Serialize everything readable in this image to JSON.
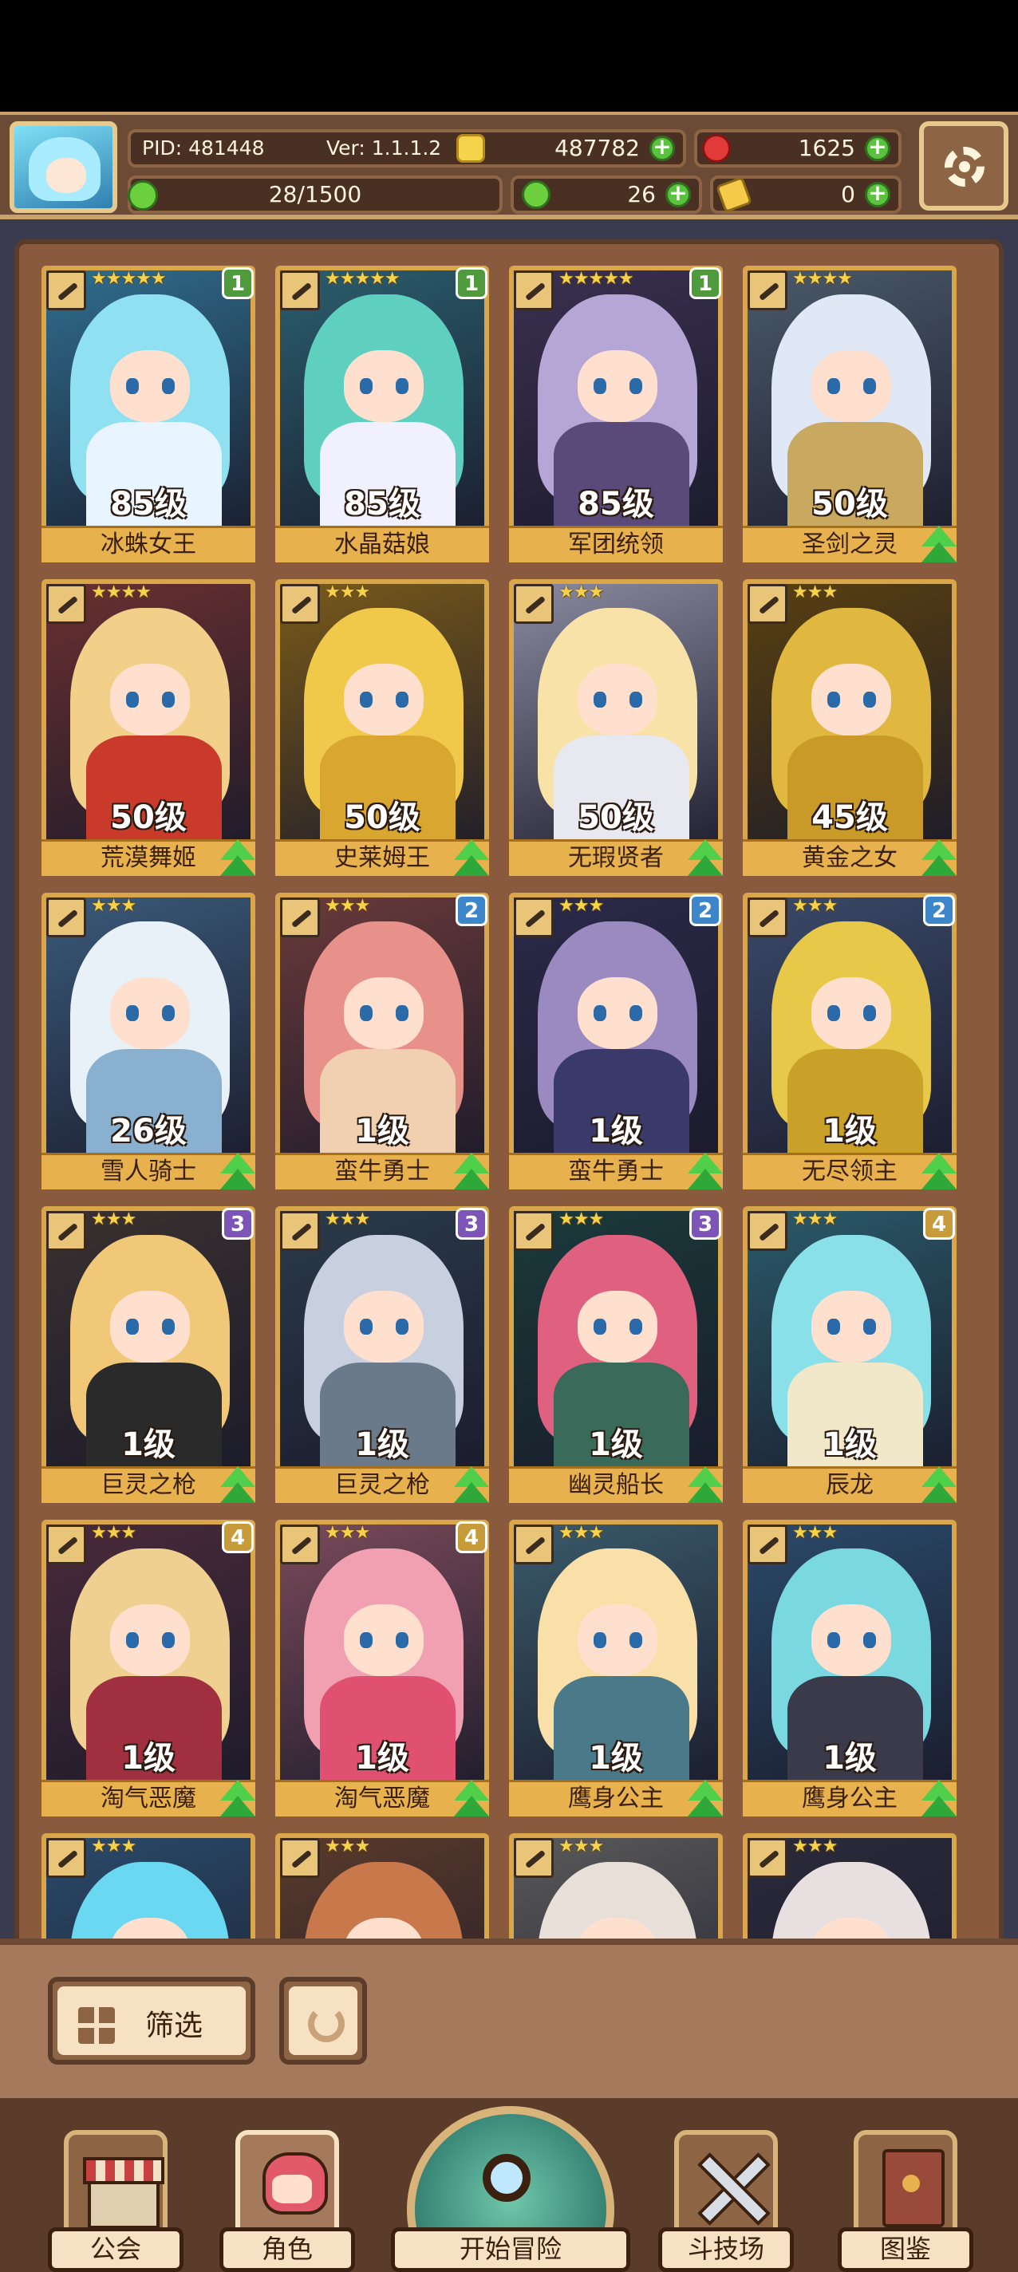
{
  "header": {
    "pid": "PID: 481448",
    "version": "Ver: 1.1.1.2",
    "gold": "487782",
    "gems": "1625",
    "energy": "28/1500",
    "clover": "26",
    "tokens": "0"
  },
  "cards": [
    {
      "name": "冰蛛女王",
      "level": "85级",
      "stars": "★★★★★",
      "rank": "1",
      "rank_color": "green",
      "upgrade": false,
      "palette": [
        "#2f6e8e",
        "#8fe0f0",
        "#e8f4ff"
      ]
    },
    {
      "name": "水晶菇娘",
      "level": "85级",
      "stars": "★★★★★",
      "rank": "1",
      "rank_color": "green",
      "upgrade": false,
      "palette": [
        "#2a5e6e",
        "#5fd0c0",
        "#f0f0ff"
      ]
    },
    {
      "name": "军团统领",
      "level": "85级",
      "stars": "★★★★★",
      "rank": "1",
      "rank_color": "green",
      "upgrade": false,
      "palette": [
        "#3a3050",
        "#b6a6d6",
        "#5a4a7a"
      ]
    },
    {
      "name": "圣剑之灵",
      "level": "50级",
      "stars": "★★★★",
      "rank": "",
      "rank_color": "",
      "upgrade": true,
      "palette": [
        "#4a5a6a",
        "#dfe8f4",
        "#c9a860"
      ]
    },
    {
      "name": "荒漠舞姬",
      "level": "50级",
      "stars": "★★★★",
      "rank": "",
      "rank_color": "",
      "upgrade": true,
      "palette": [
        "#6a3030",
        "#f2d08a",
        "#c93a2a"
      ]
    },
    {
      "name": "史莱姆王",
      "level": "50级",
      "stars": "★★★",
      "rank": "",
      "rank_color": "",
      "upgrade": true,
      "palette": [
        "#7a5a1a",
        "#f0c84a",
        "#d9a630"
      ]
    },
    {
      "name": "无瑕贤者",
      "level": "50级",
      "stars": "★★★",
      "rank": "",
      "rank_color": "",
      "upgrade": true,
      "palette": [
        "#8a8aa0",
        "#f8e2a8",
        "#e8e8f0"
      ]
    },
    {
      "name": "黄金之女",
      "level": "45级",
      "stars": "★★★",
      "rank": "",
      "rank_color": "",
      "upgrade": true,
      "palette": [
        "#5a4010",
        "#e0b840",
        "#c99a28"
      ]
    },
    {
      "name": "雪人骑士",
      "level": "26级",
      "stars": "★★★",
      "rank": "",
      "rank_color": "",
      "upgrade": true,
      "palette": [
        "#3a5a7a",
        "#e8f0f8",
        "#8ab0d0"
      ]
    },
    {
      "name": "蛮牛勇士",
      "level": "1级",
      "stars": "★★★",
      "rank": "2",
      "rank_color": "blue",
      "upgrade": true,
      "palette": [
        "#6a3a3a",
        "#e8908a",
        "#f0d0b0"
      ]
    },
    {
      "name": "蛮牛勇士",
      "level": "1级",
      "stars": "★★★",
      "rank": "2",
      "rank_color": "blue",
      "upgrade": true,
      "palette": [
        "#2a2a4a",
        "#9a8ac0",
        "#3a3a6a"
      ]
    },
    {
      "name": "无尽领主",
      "level": "1级",
      "stars": "★★★",
      "rank": "2",
      "rank_color": "blue",
      "upgrade": true,
      "palette": [
        "#3a4a6a",
        "#e8c848",
        "#c9a028"
      ]
    },
    {
      "name": "巨灵之枪",
      "level": "1级",
      "stars": "★★★",
      "rank": "3",
      "rank_color": "purple",
      "upgrade": true,
      "palette": [
        "#3a3030",
        "#f0c878",
        "#2a2a2a"
      ]
    },
    {
      "name": "巨灵之枪",
      "level": "1级",
      "stars": "★★★",
      "rank": "3",
      "rank_color": "purple",
      "upgrade": true,
      "palette": [
        "#2a3a4a",
        "#c8d0e0",
        "#6a7a8a"
      ]
    },
    {
      "name": "幽灵船长",
      "level": "1级",
      "stars": "★★★",
      "rank": "3",
      "rank_color": "purple",
      "upgrade": true,
      "palette": [
        "#1a3a3a",
        "#e06080",
        "#3a6a5a"
      ]
    },
    {
      "name": "辰龙",
      "level": "1级",
      "stars": "★★★",
      "rank": "4",
      "rank_color": "gold",
      "upgrade": true,
      "palette": [
        "#2a5a6a",
        "#8ae0e8",
        "#f0e8c8"
      ]
    },
    {
      "name": "淘气恶魔",
      "level": "1级",
      "stars": "★★★",
      "rank": "4",
      "rank_color": "gold",
      "upgrade": true,
      "palette": [
        "#4a2a3a",
        "#f0d090",
        "#a03040"
      ]
    },
    {
      "name": "淘气恶魔",
      "level": "1级",
      "stars": "★★★",
      "rank": "4",
      "rank_color": "gold",
      "upgrade": true,
      "palette": [
        "#7a4a5a",
        "#f0a0b0",
        "#e05070"
      ]
    },
    {
      "name": "鹰身公主",
      "level": "1级",
      "stars": "★★★",
      "rank": "",
      "rank_color": "",
      "upgrade": true,
      "palette": [
        "#3a5a6a",
        "#f8e0a8",
        "#4a7a8a"
      ]
    },
    {
      "name": "鹰身公主",
      "level": "1级",
      "stars": "★★★",
      "rank": "",
      "rank_color": "",
      "upgrade": true,
      "palette": [
        "#2a4a6a",
        "#7ad8e0",
        "#3a3a4a"
      ]
    },
    {
      "name": "",
      "level": "",
      "stars": "★★★",
      "rank": "",
      "rank_color": "",
      "upgrade": false,
      "palette": [
        "#2a4a6a",
        "#6ad8f0",
        "#3a8aa8"
      ]
    },
    {
      "name": "",
      "level": "",
      "stars": "★★★",
      "rank": "",
      "rank_color": "",
      "upgrade": false,
      "palette": [
        "#5a3a2a",
        "#c8784a",
        "#8a5a3a"
      ]
    },
    {
      "name": "",
      "level": "",
      "stars": "★★★",
      "rank": "",
      "rank_color": "",
      "upgrade": false,
      "palette": [
        "#5a5a5a",
        "#e8e0d8",
        "#c06a6a"
      ]
    },
    {
      "name": "",
      "level": "",
      "stars": "★★★",
      "rank": "",
      "rank_color": "",
      "upgrade": false,
      "palette": [
        "#2a2a3a",
        "#e8e0e0",
        "#4a3a5a"
      ]
    }
  ],
  "actions": {
    "filter_label": "筛选"
  },
  "nav": {
    "guild": "公会",
    "character": "角色",
    "adventure": "开始冒险",
    "arena": "斗技场",
    "codex": "图鉴"
  },
  "colors": {
    "frame_brown": "#8a5a3f",
    "card_gold": "#e7b24e",
    "upgrade_green": "#4fcf4a"
  }
}
